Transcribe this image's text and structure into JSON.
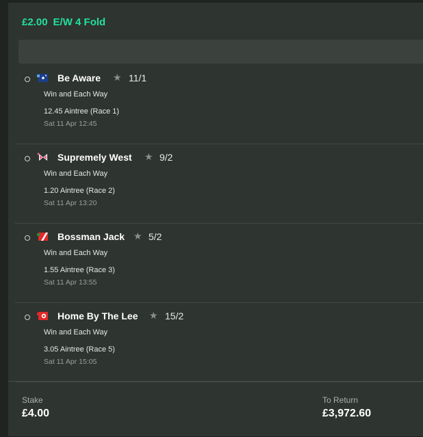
{
  "header": {
    "stake_text": "£2.00",
    "bet_type": "E/W 4 Fold"
  },
  "selections": [
    {
      "runner": "Be Aware",
      "odds": "11/1",
      "market": "Win and Each Way",
      "race": "12.45 Aintree (Race 1)",
      "time": "Sat 11 Apr 12:45",
      "silk_icon": "silk-blue-stars-icon"
    },
    {
      "runner": "Supremely West",
      "odds": "9/2",
      "market": "Win and Each Way",
      "race": "1.20 Aintree (Race 2)",
      "time": "Sat 11 Apr 13:20",
      "silk_icon": "silk-pink-bow-icon"
    },
    {
      "runner": "Bossman Jack",
      "odds": "5/2",
      "market": "Win and Each Way",
      "race": "1.55 Aintree (Race 3)",
      "time": "Sat 11 Apr 13:55",
      "silk_icon": "silk-red-diagonal-icon"
    },
    {
      "runner": "Home By The Lee",
      "odds": "15/2",
      "market": "Win and Each Way",
      "race": "3.05 Aintree (Race 5)",
      "time": "Sat 11 Apr 15:05",
      "silk_icon": "silk-red-white-icon"
    }
  ],
  "footer": {
    "stake_label": "Stake",
    "stake_value": "£4.00",
    "return_label": "To Return",
    "return_value": "£3,972.60"
  },
  "colors": {
    "accent": "#22e0a0",
    "panel": "#2e3430",
    "background": "#1f2421"
  }
}
